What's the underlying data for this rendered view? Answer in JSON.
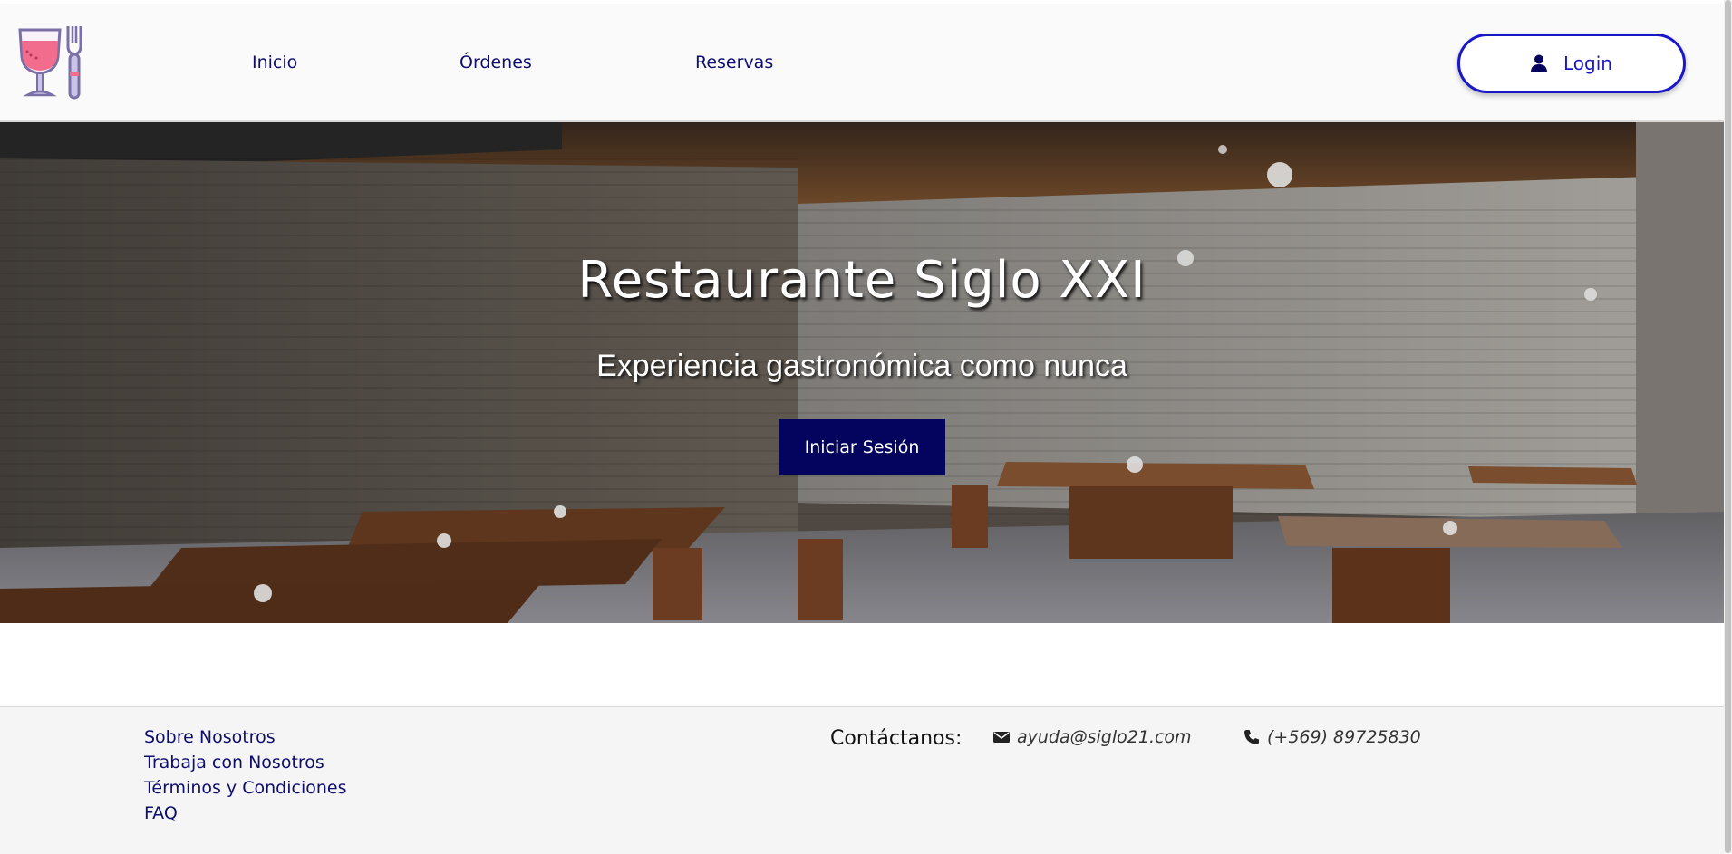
{
  "nav": {
    "links": [
      "Inicio",
      "Órdenes",
      "Reservas"
    ],
    "login_label": "Login"
  },
  "hero": {
    "title": "Restaurante Siglo XXI",
    "subtitle": "Experiencia gastronómica como nunca",
    "cta": "Iniciar Sesión"
  },
  "footer": {
    "links": [
      "Sobre Nosotros",
      "Trabaja con Nosotros",
      "Términos y Condiciones",
      "FAQ"
    ],
    "contact_title": "Contáctanos:",
    "email": "ayuda@siglo21.com",
    "phone": "(+569) 89725830"
  },
  "icons": {
    "logo": "wine-glass-fork-icon",
    "login": "user-icon",
    "email": "envelope-icon",
    "phone": "phone-icon"
  },
  "colors": {
    "primary": "#04045e",
    "accent": "#1a17c8",
    "nav_text": "#0e0e6e"
  }
}
